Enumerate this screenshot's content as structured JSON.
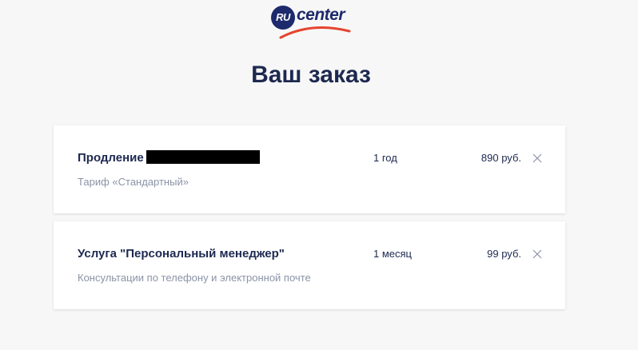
{
  "logo": {
    "badge": "RU",
    "word": "center",
    "colors": {
      "navy": "#1d2a6b",
      "swoosh": "#e5442e"
    }
  },
  "title": "Ваш заказ",
  "order_items": [
    {
      "name": "Продление",
      "name_redacted": true,
      "description": "Тариф «Стандартный»",
      "period": "1 год",
      "price": "890 руб.",
      "remove_icon": "close-icon"
    },
    {
      "name": "Услуга \"Персональный менеджер\"",
      "description": "Консультации по телефону и электронной почте",
      "period": "1 месяц",
      "price": "99 руб.",
      "remove_icon": "close-icon"
    }
  ],
  "colors": {
    "background": "#f7f7f7",
    "card": "#ffffff",
    "text": "#1d2950",
    "muted": "#8a93a6"
  }
}
